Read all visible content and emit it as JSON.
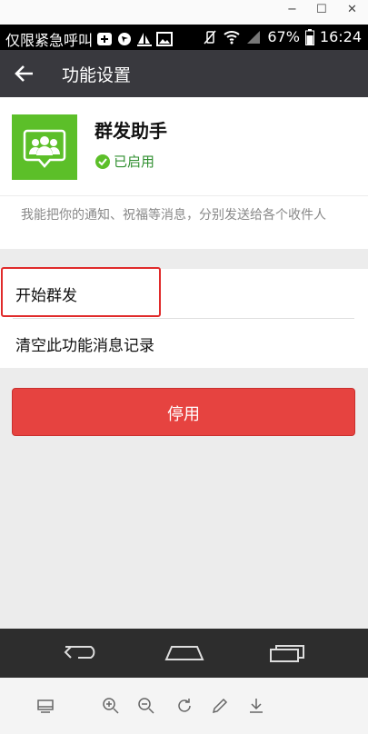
{
  "window": {
    "minimize": "−",
    "maximize": "☐",
    "close": "✕"
  },
  "status_bar": {
    "carrier": "仅限紧急呼叫",
    "battery": "67%",
    "time": "16:24"
  },
  "header": {
    "title": "功能设置"
  },
  "plugin": {
    "name": "群发助手",
    "status": "已启用",
    "description": "我能把你的通知、祝福等消息，分别发送给各个收件人"
  },
  "menu": {
    "items": [
      {
        "label": "开始群发"
      },
      {
        "label": "清空此功能消息记录"
      }
    ]
  },
  "disable_button": {
    "label": "停用"
  },
  "colors": {
    "header": "#39393e",
    "accent": "#5cbf29",
    "danger": "#e64340"
  }
}
